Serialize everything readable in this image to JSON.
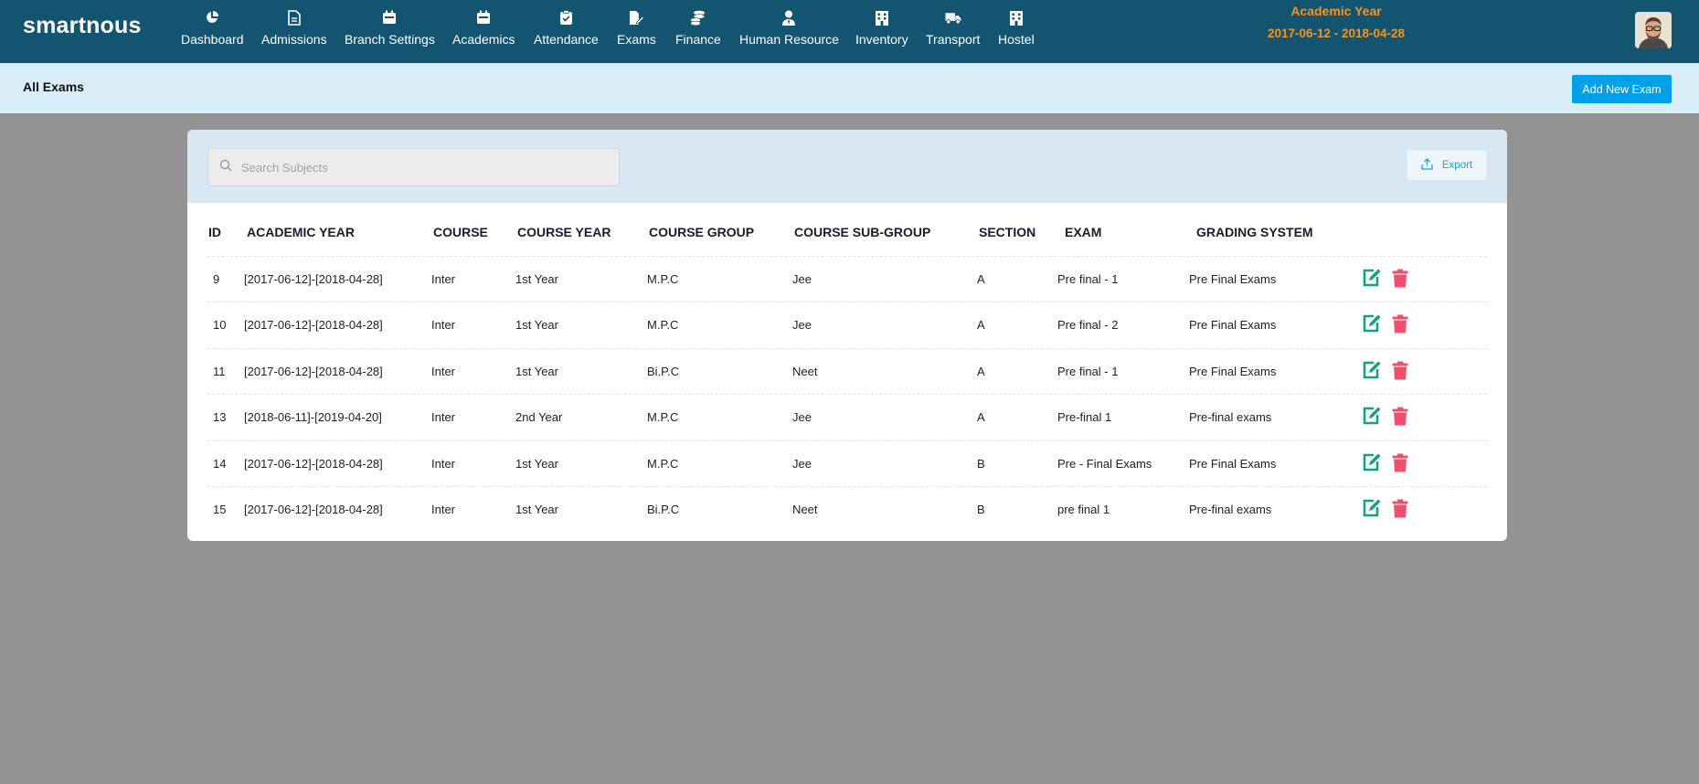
{
  "brand": "smartnous",
  "nav": [
    {
      "label": "Dashboard",
      "icon": "pie-chart-icon"
    },
    {
      "label": "Admissions",
      "icon": "document-icon"
    },
    {
      "label": "Branch Settings",
      "icon": "calendar-icon"
    },
    {
      "label": "Academics",
      "icon": "calendar-icon"
    },
    {
      "label": "Attendance",
      "icon": "clipboard-check-icon"
    },
    {
      "label": "Exams",
      "icon": "file-edit-icon"
    },
    {
      "label": "Finance",
      "icon": "coins-icon"
    },
    {
      "label": "Human Resource",
      "icon": "user-tie-icon"
    },
    {
      "label": "Inventory",
      "icon": "building-icon"
    },
    {
      "label": "Transport",
      "icon": "truck-icon"
    },
    {
      "label": "Hostel",
      "icon": "building-icon"
    }
  ],
  "academic_year": {
    "title": "Academic Year",
    "range": "2017-06-12 - 2018-04-28"
  },
  "page": {
    "title": "All Exams",
    "add_button": "Add New Exam"
  },
  "search": {
    "placeholder": "Search Subjects"
  },
  "export": {
    "label": "Export"
  },
  "table": {
    "headers": [
      "ID",
      "ACADEMIC YEAR",
      "COURSE",
      "COURSE YEAR",
      "COURSE GROUP",
      "COURSE SUB-GROUP",
      "SECTION",
      "EXAM",
      "GRADING SYSTEM"
    ],
    "rows": [
      [
        "9",
        "[2017-06-12]-[2018-04-28]",
        "Inter",
        "1st Year",
        "M.P.C",
        "Jee",
        "A",
        "Pre final - 1",
        "Pre Final Exams"
      ],
      [
        "10",
        "[2017-06-12]-[2018-04-28]",
        "Inter",
        "1st Year",
        "M.P.C",
        "Jee",
        "A",
        "Pre final - 2",
        "Pre Final Exams"
      ],
      [
        "11",
        "[2017-06-12]-[2018-04-28]",
        "Inter",
        "1st Year",
        "Bi.P.C",
        "Neet",
        "A",
        "Pre final - 1",
        "Pre Final Exams"
      ],
      [
        "13",
        "[2018-06-11]-[2019-04-20]",
        "Inter",
        "2nd Year",
        "M.P.C",
        "Jee",
        "A",
        "Pre-final 1",
        "Pre-final exams"
      ],
      [
        "14",
        "[2017-06-12]-[2018-04-28]",
        "Inter",
        "1st Year",
        "M.P.C",
        "Jee",
        "B",
        "Pre - Final Exams",
        "Pre Final Exams"
      ],
      [
        "15",
        "[2017-06-12]-[2018-04-28]",
        "Inter",
        "1st Year",
        "Bi.P.C",
        "Neet",
        "B",
        "pre final 1",
        "Pre-final exams"
      ]
    ]
  },
  "colors": {
    "topbar": "#135571",
    "accent_orange": "#f4941e",
    "primary_button": "#00a0e9",
    "edit_icon": "#16a085",
    "delete_icon": "#f0506e"
  }
}
